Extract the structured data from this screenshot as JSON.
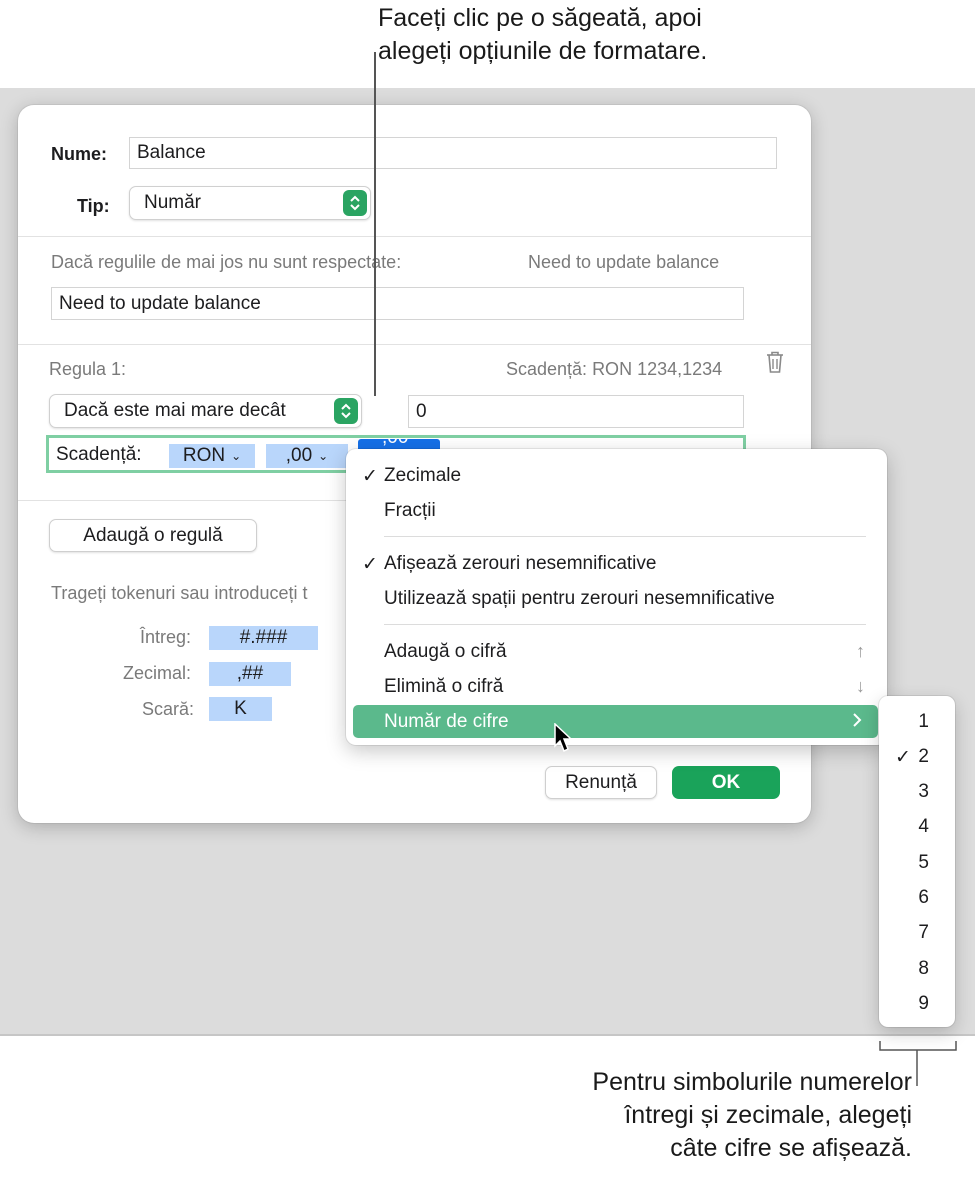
{
  "callouts": {
    "top_line1": "Faceți clic pe o săgeată, apoi",
    "top_line2": "alegeți opțiunile de formatare.",
    "bottom_line1": "Pentru simbolurile numerelor",
    "bottom_line2": "întregi și zecimale, alegeți",
    "bottom_line3": "câte cifre se afișează."
  },
  "dialog": {
    "name_label": "Nume:",
    "name_value": "Balance",
    "type_label": "Tip:",
    "type_value": "Număr",
    "fallback_label": "Dacă regulile de mai jos nu sunt respectate:",
    "fallback_preview": "Need to update balance",
    "fallback_value": "Need to update balance",
    "rule_label": "Regula 1:",
    "rule_preview": "Scadență: RON 1234,1234",
    "condition_value": "Dacă este mai mare decât",
    "condition_number": "0",
    "format_prefix": "Scadență:",
    "token_currency": "RON",
    "token_decimal": ",00",
    "token_partial": ",00",
    "add_rule_label": "Adaugă o regulă",
    "tokens_hint": "Trageți tokenuri sau introduceți t",
    "integer_label": "Întreg:",
    "integer_token": "#.###",
    "decimal_label": "Zecimal:",
    "decimal_token": ",##",
    "scale_label": "Scară:",
    "scale_token": "K",
    "cancel_label": "Renunță",
    "ok_label": "OK"
  },
  "menu": {
    "item_decimals": "Zecimale",
    "item_fractions": "Fracții",
    "item_show_zeros": "Afișează zerouri nesemnificative",
    "item_spaces": "Utilizează spații pentru zerouri nesemnificative",
    "item_add_digit": "Adaugă o cifră",
    "item_add_digit_key": "↑",
    "item_remove_digit": "Elimină o cifră",
    "item_remove_digit_key": "↓",
    "item_num_digits": "Număr de cifre",
    "check_glyph": "✓"
  },
  "submenu": {
    "selected": "2",
    "items": [
      "1",
      "2",
      "3",
      "4",
      "5",
      "6",
      "7",
      "8",
      "9"
    ]
  },
  "colors": {
    "accent_green": "#1aa35a",
    "highlight_green": "#5bb98c",
    "token_blue": "#b9d6fb"
  }
}
